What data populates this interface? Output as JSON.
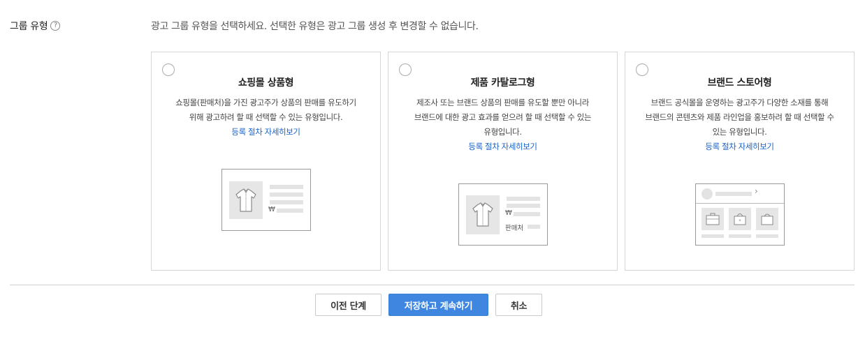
{
  "field": {
    "label": "그룹 유형",
    "help_icon": "question-circle-icon",
    "help_glyph": "?",
    "description": "광고 그룹 유형을 선택하세요. 선택한 유형은 광고 그룹 생성 후 변경할 수 없습니다."
  },
  "cards": [
    {
      "title": "쇼핑몰 상품형",
      "lines": [
        "쇼핑몰(판매처)을 가진 광고주가 상품의 판매를 유도하기",
        "위해 광고하려 할 때 선택할 수 있는 유형입니다."
      ],
      "link": "등록 절차 자세히보기",
      "illustration": {
        "icon": "shirt-icon",
        "price_symbol": "₩"
      },
      "selected": false
    },
    {
      "title": "제품 카탈로그형",
      "lines": [
        "제조사 또는 브랜드 상품의 판매를 유도할 뿐만 아니라",
        "브랜드에 대한 광고 효과를 얻으려 할 때 선택할 수 있는",
        "유형입니다."
      ],
      "link": "등록 절차 자세히보기",
      "illustration": {
        "icon": "shirt-icon",
        "price_symbol": "₩",
        "seller_label": "판매처"
      },
      "selected": false
    },
    {
      "title": "브랜드 스토어형",
      "lines": [
        "브랜드 공식몰을 운영하는 광고주가 다양한 소재를 통해",
        "브랜드의 콘텐츠와 제품 라인업을 홍보하려 할 때 선택할 수",
        "있는 유형입니다."
      ],
      "link": "등록 절차 자세히보기",
      "illustration": {
        "icons": [
          "briefcase-icon",
          "bag-icon",
          "bag-icon"
        ],
        "chevron": "›"
      },
      "selected": false
    }
  ],
  "buttons": {
    "prev": "이전 단계",
    "save": "저장하고 계속하기",
    "cancel": "취소"
  },
  "colors": {
    "primary": "#3f86e0",
    "link": "#1a63c9",
    "border": "#d6d6d6"
  }
}
